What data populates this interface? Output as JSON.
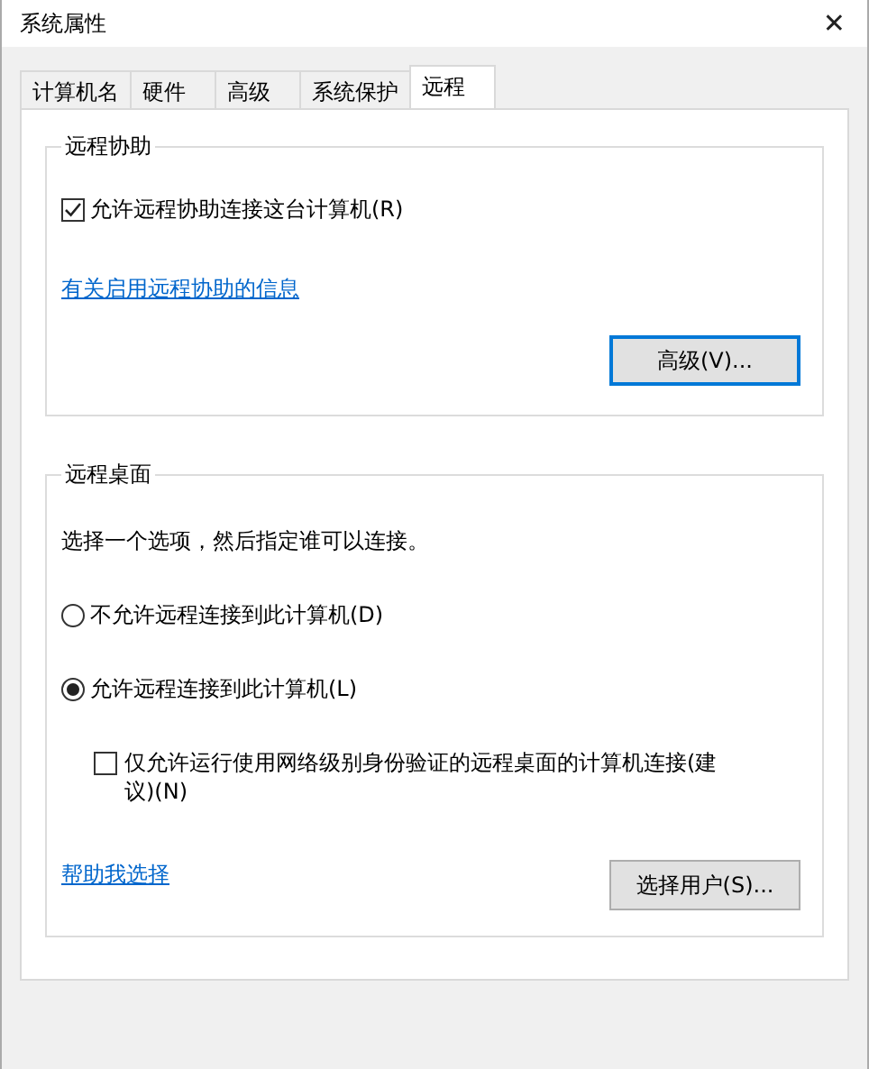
{
  "window": {
    "title": "系统属性",
    "close": "✕"
  },
  "tabs": [
    {
      "label": "计算机名",
      "selected": false
    },
    {
      "label": "硬件",
      "selected": false
    },
    {
      "label": "高级",
      "selected": false
    },
    {
      "label": "系统保护",
      "selected": false
    },
    {
      "label": "远程",
      "selected": true
    }
  ],
  "remote_assistance": {
    "title": "远程协助",
    "checkbox": {
      "label": "允许远程协助连接这台计算机(R)",
      "checked": true
    },
    "link": "有关启用远程协助的信息",
    "button": {
      "label": "高级(V)...",
      "default": true
    }
  },
  "remote_desktop": {
    "title": "远程桌面",
    "description": "选择一个选项，然后指定谁可以连接。",
    "options": [
      {
        "label": "不允许远程连接到此计算机(D)",
        "selected": false
      },
      {
        "label": "允许远程连接到此计算机(L)",
        "selected": true
      }
    ],
    "nla_checkbox": {
      "label": "仅允许运行使用网络级别身份验证的远程桌面的计算机连接(建议)(N)",
      "checked": false
    },
    "link": "帮助我选择",
    "button": {
      "label": "选择用户(S)...",
      "default": false
    }
  }
}
